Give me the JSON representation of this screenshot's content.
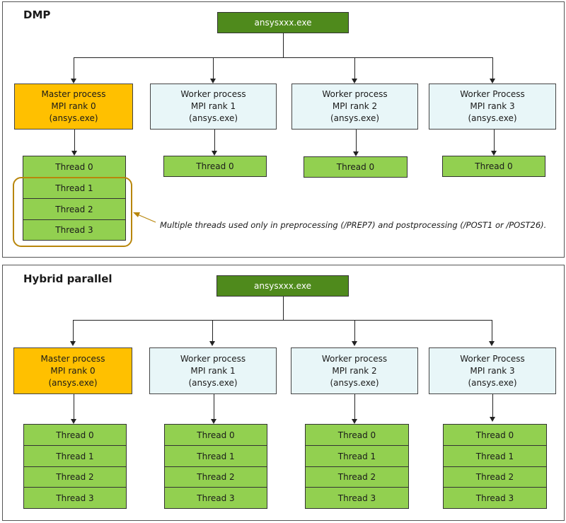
{
  "panels": [
    {
      "title": "DMP",
      "root": "ansysxxx.exe",
      "processes": [
        {
          "role": "master",
          "lines": [
            "Master process",
            "MPI rank 0",
            "(ansys.exe)"
          ],
          "threads": [
            "Thread 0",
            "Thread 1",
            "Thread 2",
            "Thread 3"
          ]
        },
        {
          "role": "worker",
          "lines": [
            "Worker process",
            "MPI rank 1",
            "(ansys.exe)"
          ],
          "threads": [
            "Thread 0"
          ]
        },
        {
          "role": "worker",
          "lines": [
            "Worker process",
            "MPI rank 2",
            "(ansys.exe)"
          ],
          "threads": [
            "Thread 0"
          ]
        },
        {
          "role": "worker",
          "lines": [
            "Worker Process",
            "MPI rank 3",
            "(ansys.exe)"
          ],
          "threads": [
            "Thread 0"
          ]
        }
      ],
      "note": "Multiple threads used only in preprocessing (/PREP7) and postprocessing (/POST1 or /POST26)."
    },
    {
      "title": "Hybrid parallel",
      "root": "ansysxxx.exe",
      "processes": [
        {
          "role": "master",
          "lines": [
            "Master process",
            "MPI rank 0",
            "(ansys.exe)"
          ],
          "threads": [
            "Thread 0",
            "Thread 1",
            "Thread 2",
            "Thread 3"
          ]
        },
        {
          "role": "worker",
          "lines": [
            "Worker process",
            "MPI rank 1",
            "(ansys.exe)"
          ],
          "threads": [
            "Thread 0",
            "Thread 1",
            "Thread 2",
            "Thread 3"
          ]
        },
        {
          "role": "worker",
          "lines": [
            "Worker process",
            "MPI rank 2",
            "(ansys.exe)"
          ],
          "threads": [
            "Thread 0",
            "Thread 1",
            "Thread 2",
            "Thread 3"
          ]
        },
        {
          "role": "worker",
          "lines": [
            "Worker Process",
            "MPI rank 3",
            "(ansys.exe)"
          ],
          "threads": [
            "Thread 0",
            "Thread 1",
            "Thread 2",
            "Thread 3"
          ]
        }
      ]
    }
  ],
  "colors": {
    "root_box": "#4f8a1c",
    "master_box": "#ffc000",
    "worker_box": "#e8f6f8",
    "thread_box": "#92d050",
    "highlight": "#b8860b"
  }
}
